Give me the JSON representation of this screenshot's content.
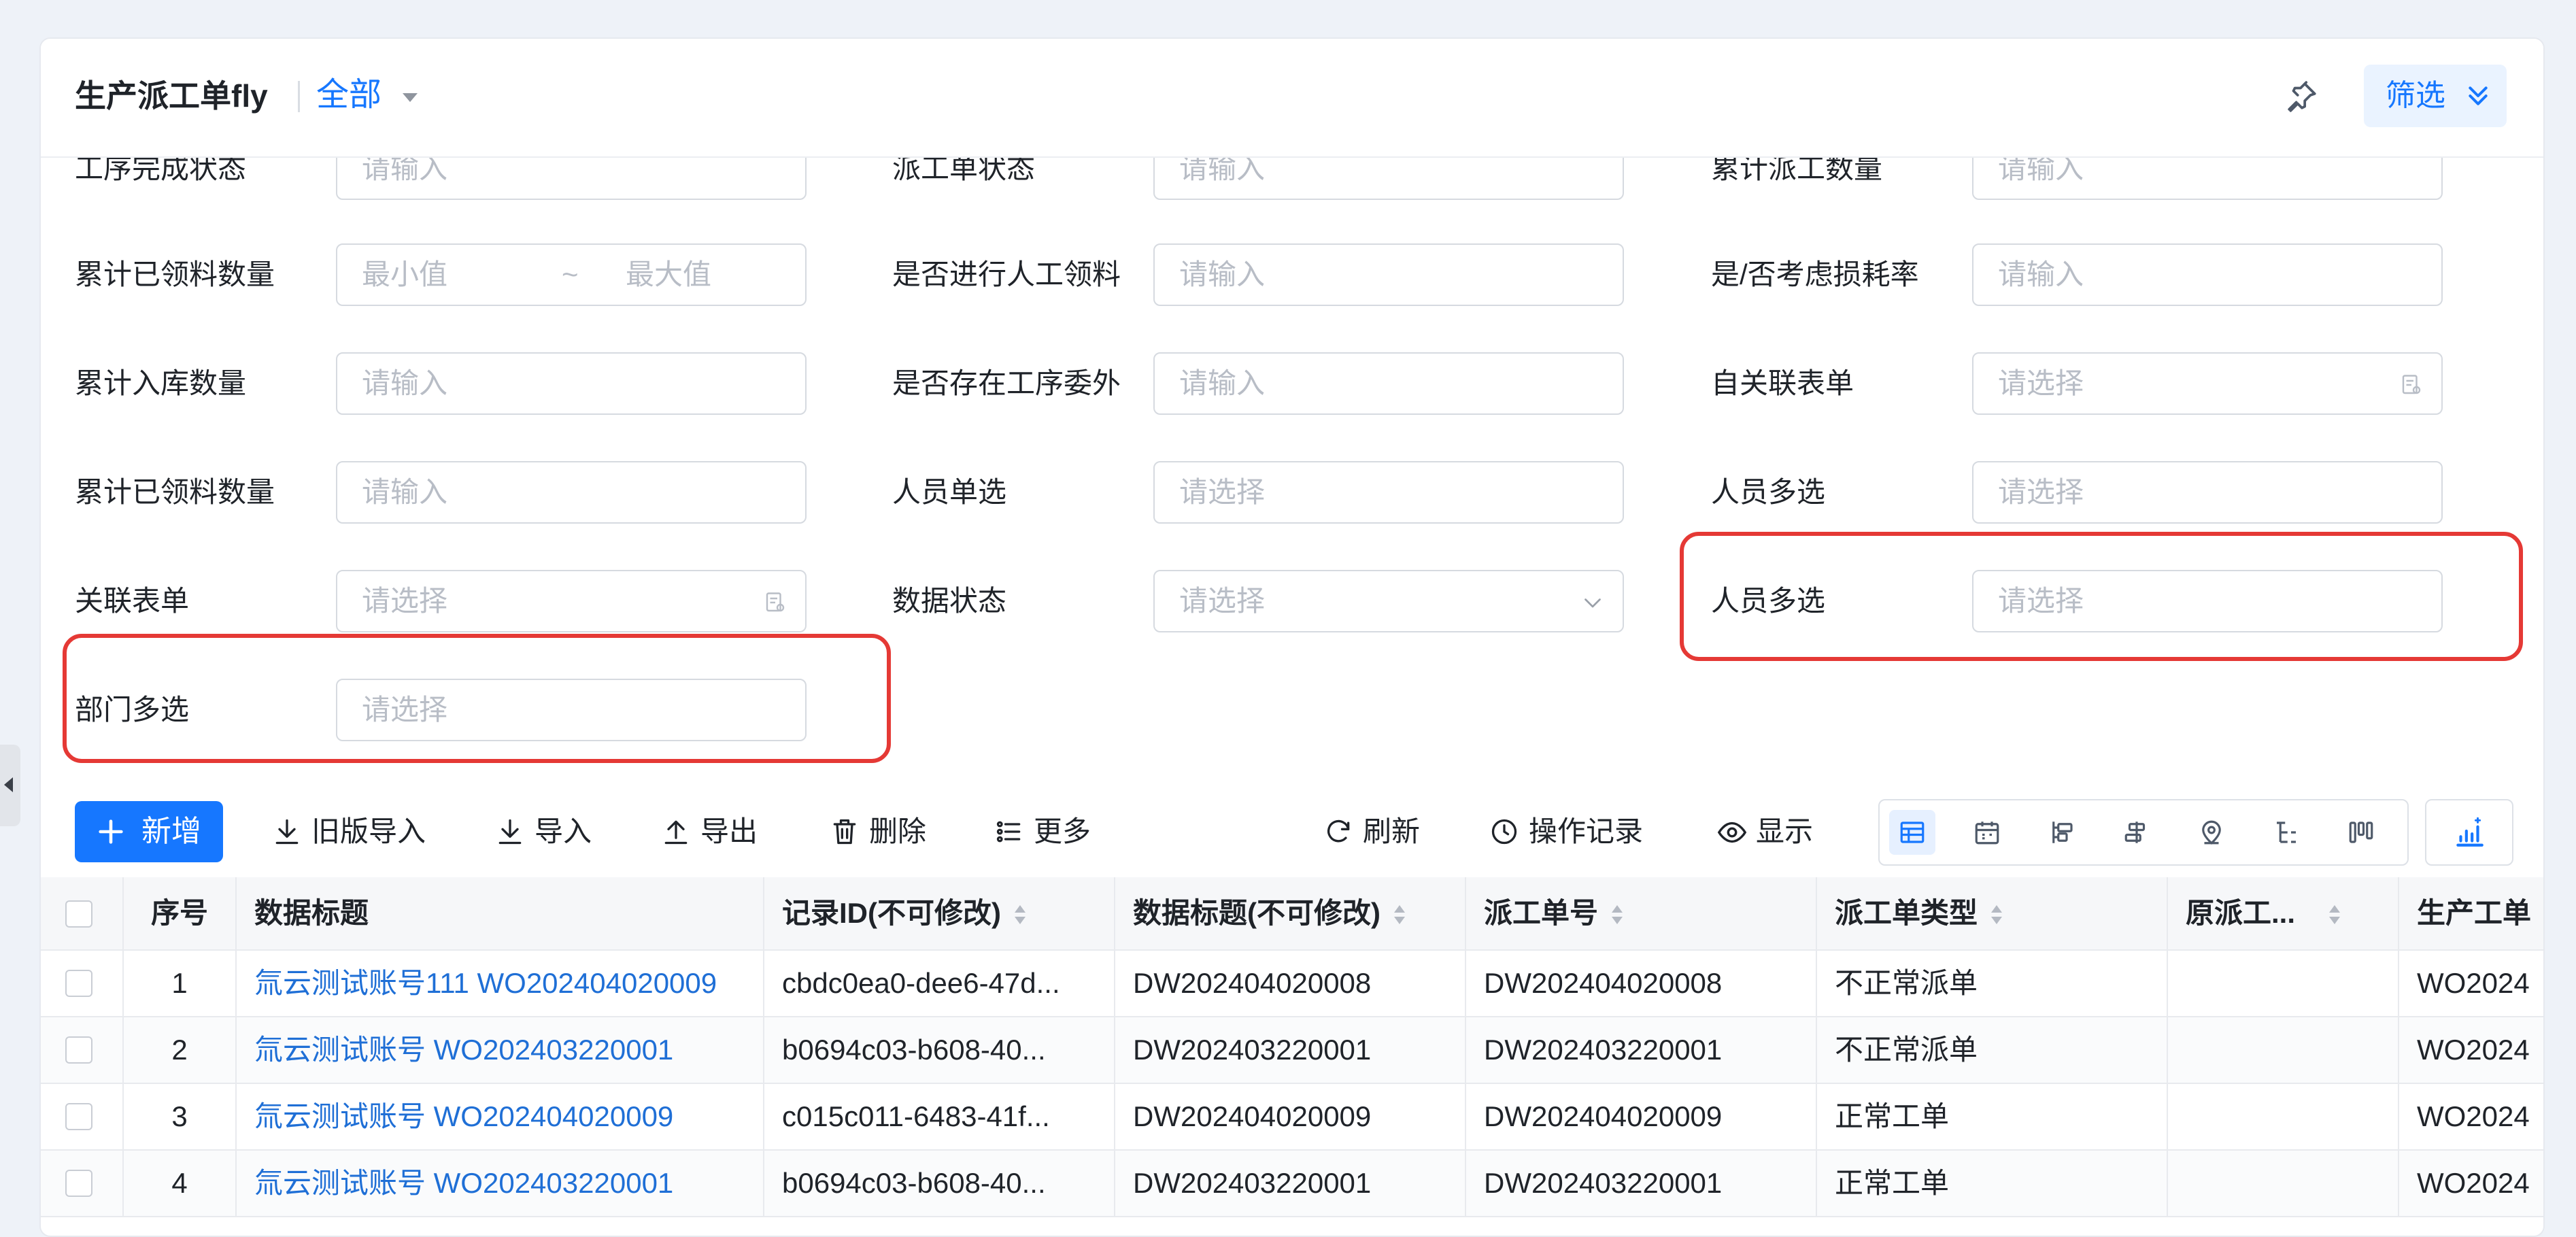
{
  "header": {
    "title": "生产派工单fly",
    "view_label": "全部",
    "filter_label": "筛选"
  },
  "filters": {
    "row0": [
      {
        "label": "工序完成状态",
        "placeholder": "请输入"
      },
      {
        "label": "派工单状态",
        "placeholder": "请输入"
      },
      {
        "label": "累计派工数量",
        "placeholder": "请输入"
      }
    ],
    "row1": [
      {
        "label": "累计已领料数量",
        "min_placeholder": "最小值",
        "tilde": "~",
        "max_placeholder": "最大值"
      },
      {
        "label": "是否进行人工领料",
        "placeholder": "请输入"
      },
      {
        "label": "是/否考虑损耗率",
        "placeholder": "请输入"
      }
    ],
    "row2": [
      {
        "label": "累计入库数量",
        "placeholder": "请输入"
      },
      {
        "label": "是否存在工序委外",
        "placeholder": "请输入"
      },
      {
        "label": "自关联表单",
        "placeholder": "请选择"
      }
    ],
    "row3": [
      {
        "label": "累计已领料数量",
        "placeholder": "请输入"
      },
      {
        "label": "人员单选",
        "placeholder": "请选择"
      },
      {
        "label": "人员多选",
        "placeholder": "请选择"
      }
    ],
    "row4": [
      {
        "label": "关联表单",
        "placeholder": "请选择"
      },
      {
        "label": "数据状态",
        "placeholder": "请选择"
      },
      {
        "label": "人员多选",
        "placeholder": "请选择"
      }
    ],
    "row5": [
      {
        "label": "部门多选",
        "placeholder": "请选择"
      }
    ]
  },
  "toolbar": {
    "add": "新增",
    "old_import": "旧版导入",
    "import": "导入",
    "export": "导出",
    "delete": "删除",
    "more": "更多",
    "refresh": "刷新",
    "history": "操作记录",
    "display": "显示"
  },
  "table": {
    "columns": [
      "序号",
      "数据标题",
      "记录ID(不可修改)",
      "数据标题(不可修改)",
      "派工单号",
      "派工单类型",
      "原派工...",
      "生产工单"
    ],
    "rows": [
      {
        "no": "1",
        "title": "氚云测试账号111 WO202404020009",
        "record_id": "cbdc0ea0-dee6-47d...",
        "title_fixed": "DW202404020008",
        "dispatch_no": "DW202404020008",
        "type": "不正常派单",
        "orig": "",
        "wo": "WO2024"
      },
      {
        "no": "2",
        "title": "氚云测试账号 WO202403220001",
        "record_id": "b0694c03-b608-40...",
        "title_fixed": "DW202403220001",
        "dispatch_no": "DW202403220001",
        "type": "不正常派单",
        "orig": "",
        "wo": "WO2024"
      },
      {
        "no": "3",
        "title": "氚云测试账号 WO202404020009",
        "record_id": "c015c011-6483-41f...",
        "title_fixed": "DW202404020009",
        "dispatch_no": "DW202404020009",
        "type": "正常工单",
        "orig": "",
        "wo": "WO2024"
      },
      {
        "no": "4",
        "title": "氚云测试账号 WO202403220001",
        "record_id": "b0694c03-b608-40...",
        "title_fixed": "DW202403220001",
        "dispatch_no": "DW202403220001",
        "type": "正常工单",
        "orig": "",
        "wo": "WO2024"
      }
    ]
  },
  "colors": {
    "primary": "#1677ff",
    "highlight": "#e53935",
    "link": "#1f6fd6"
  }
}
